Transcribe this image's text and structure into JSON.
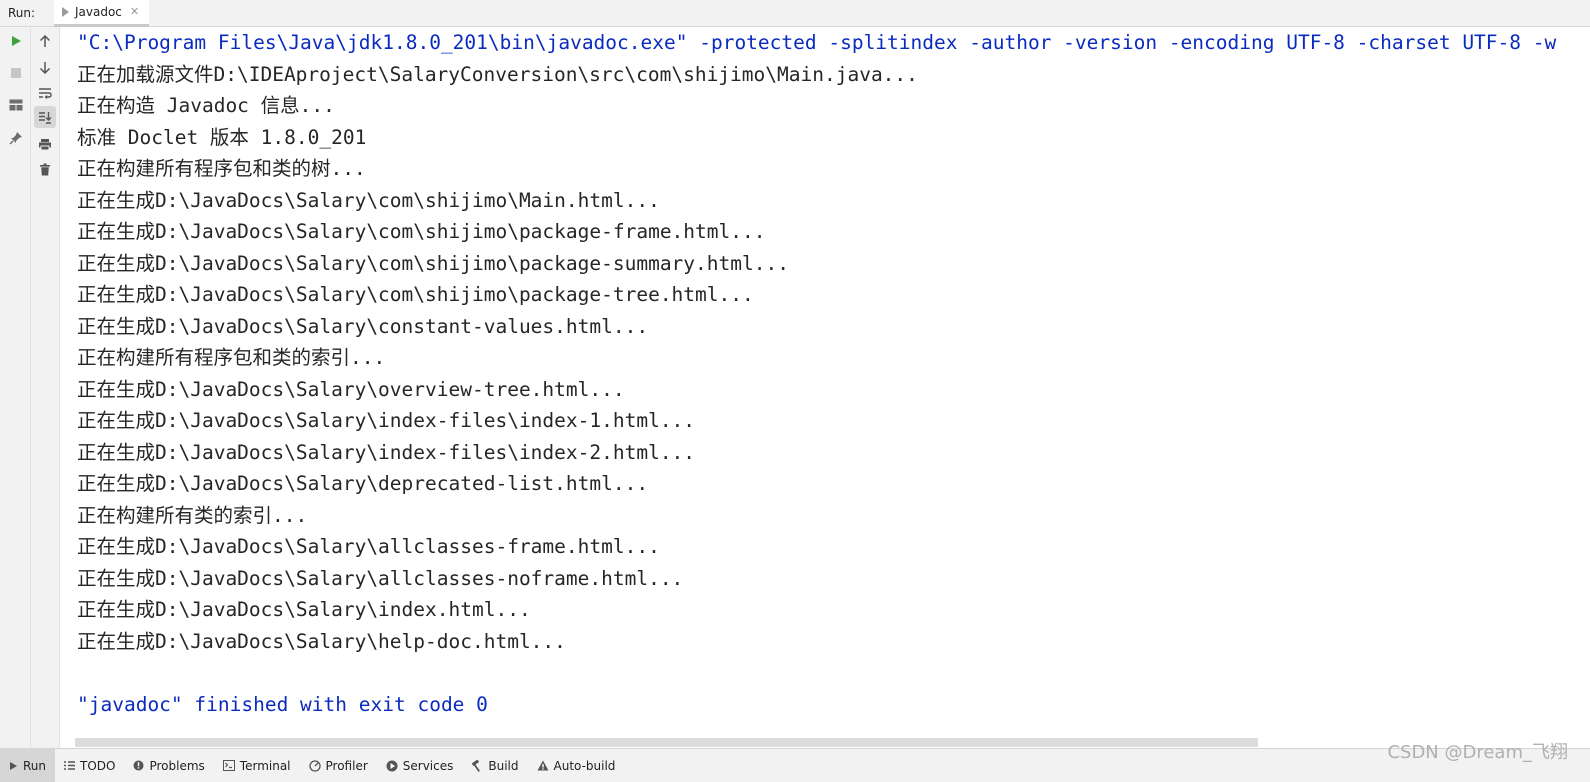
{
  "run_bar": {
    "label": "Run:",
    "tab": "Javadoc"
  },
  "console": {
    "command": "\"C:\\Program Files\\Java\\jdk1.8.0_201\\bin\\javadoc.exe\" -protected -splitindex -author -version -encoding UTF-8 -charset UTF-8 -w",
    "lines": [
      "正在加载源文件D:\\IDEAproject\\SalaryConversion\\src\\com\\shijimo\\Main.java...",
      "正在构造 Javadoc 信息...",
      "标准 Doclet 版本 1.8.0_201",
      "正在构建所有程序包和类的树...",
      "正在生成D:\\JavaDocs\\Salary\\com\\shijimo\\Main.html...",
      "正在生成D:\\JavaDocs\\Salary\\com\\shijimo\\package-frame.html...",
      "正在生成D:\\JavaDocs\\Salary\\com\\shijimo\\package-summary.html...",
      "正在生成D:\\JavaDocs\\Salary\\com\\shijimo\\package-tree.html...",
      "正在生成D:\\JavaDocs\\Salary\\constant-values.html...",
      "正在构建所有程序包和类的索引...",
      "正在生成D:\\JavaDocs\\Salary\\overview-tree.html...",
      "正在生成D:\\JavaDocs\\Salary\\index-files\\index-1.html...",
      "正在生成D:\\JavaDocs\\Salary\\index-files\\index-2.html...",
      "正在生成D:\\JavaDocs\\Salary\\deprecated-list.html...",
      "正在构建所有类的索引...",
      "正在生成D:\\JavaDocs\\Salary\\allclasses-frame.html...",
      "正在生成D:\\JavaDocs\\Salary\\allclasses-noframe.html...",
      "正在生成D:\\JavaDocs\\Salary\\index.html...",
      "正在生成D:\\JavaDocs\\Salary\\help-doc.html..."
    ],
    "exit_message": "\"javadoc\" finished with exit code 0"
  },
  "toolbar_left": {
    "icons": [
      "run-icon",
      "stop-icon",
      "layout-icon",
      "pin-icon"
    ]
  },
  "toolbar_right": {
    "icons": [
      "up-arrow-icon",
      "down-arrow-icon",
      "soft-wrap-icon",
      "scroll-to-end-icon",
      "print-icon",
      "trash-icon"
    ]
  },
  "bottom_bar": {
    "tabs": [
      "Run",
      "TODO",
      "Problems",
      "Terminal",
      "Profiler",
      "Services",
      "Build",
      "Auto-build"
    ]
  },
  "watermark": "CSDN @Dream_飞翔",
  "colors": {
    "command": "#0b2bc0",
    "text": "#262626",
    "run_green": "#3ea33e",
    "toolbar_bg": "#f2f2f2"
  }
}
